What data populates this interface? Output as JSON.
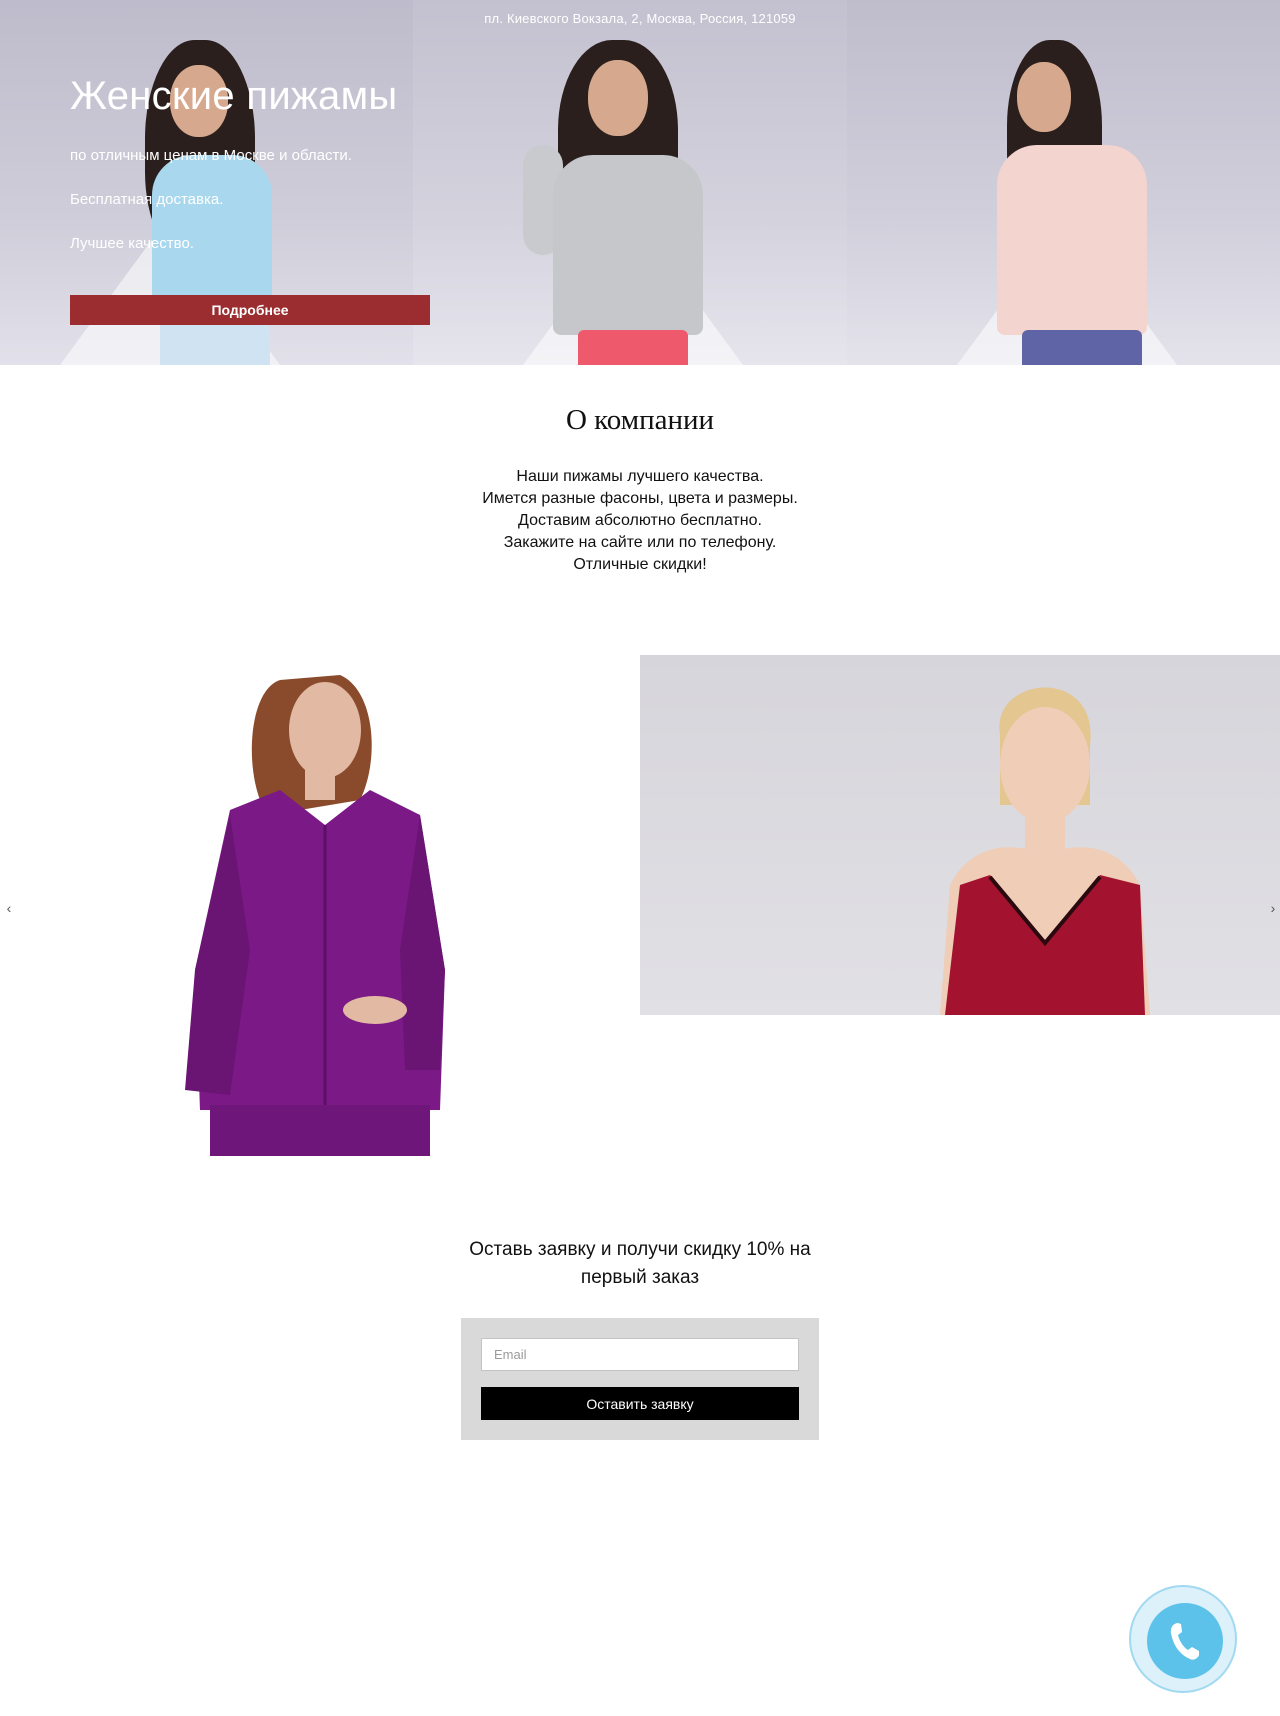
{
  "hero": {
    "address": "пл. Киевского Вокзала, 2, Москва, Россия, 121059",
    "title": "Женские пижамы",
    "lines": [
      "по отличным ценам в Москве и области.",
      "Бесплатная доставка.",
      "Лучшее качество."
    ],
    "button_label": "Подробнее",
    "button_color": "#9b2d30"
  },
  "about": {
    "title": "О компании",
    "lines": [
      "Наши пижамы лучшего качества.",
      "Имется разные фасоны, цвета и размеры.",
      "Доставим абсолютно бесплатно.",
      "Закажите на сайте или по телефону.",
      "Отличные скидки!"
    ]
  },
  "gallery": {
    "prev_glyph": "‹",
    "next_glyph": "›"
  },
  "cta": {
    "title_line1": "Оставь заявку и получи скидку 10% на",
    "title_line2": "первый заказ",
    "email_placeholder": "Email",
    "submit_label": "Оставить заявку"
  },
  "call_widget": {
    "icon": "phone-icon",
    "color": "#5cc2ea"
  }
}
